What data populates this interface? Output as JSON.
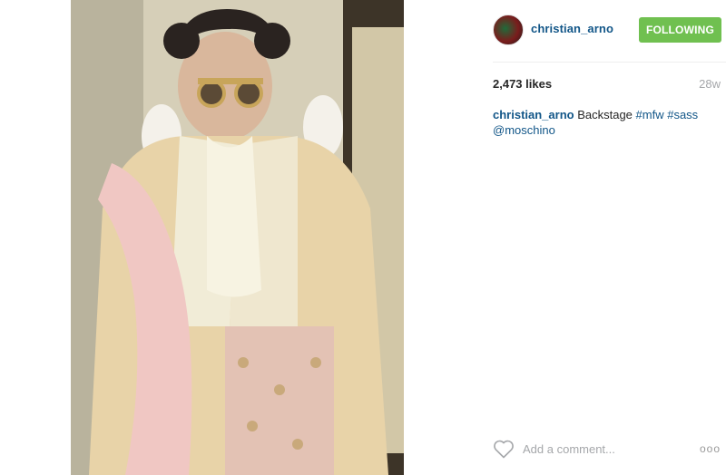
{
  "post": {
    "username": "christian_arno",
    "follow_label": "FOLLOWING",
    "likes": "2,473 likes",
    "age": "28w",
    "caption": {
      "user": "christian_arno",
      "text": " Backstage ",
      "tags": [
        "#mfw",
        "#sass"
      ],
      "mention": "@moschino"
    }
  },
  "comment": {
    "placeholder": "Add a comment...",
    "more_label": "ooo"
  },
  "icons": {
    "like": "heart-icon",
    "more": "more-options-icon"
  },
  "colors": {
    "link": "#125688",
    "follow_button": "#70c050",
    "muted": "#a5a7aa"
  }
}
